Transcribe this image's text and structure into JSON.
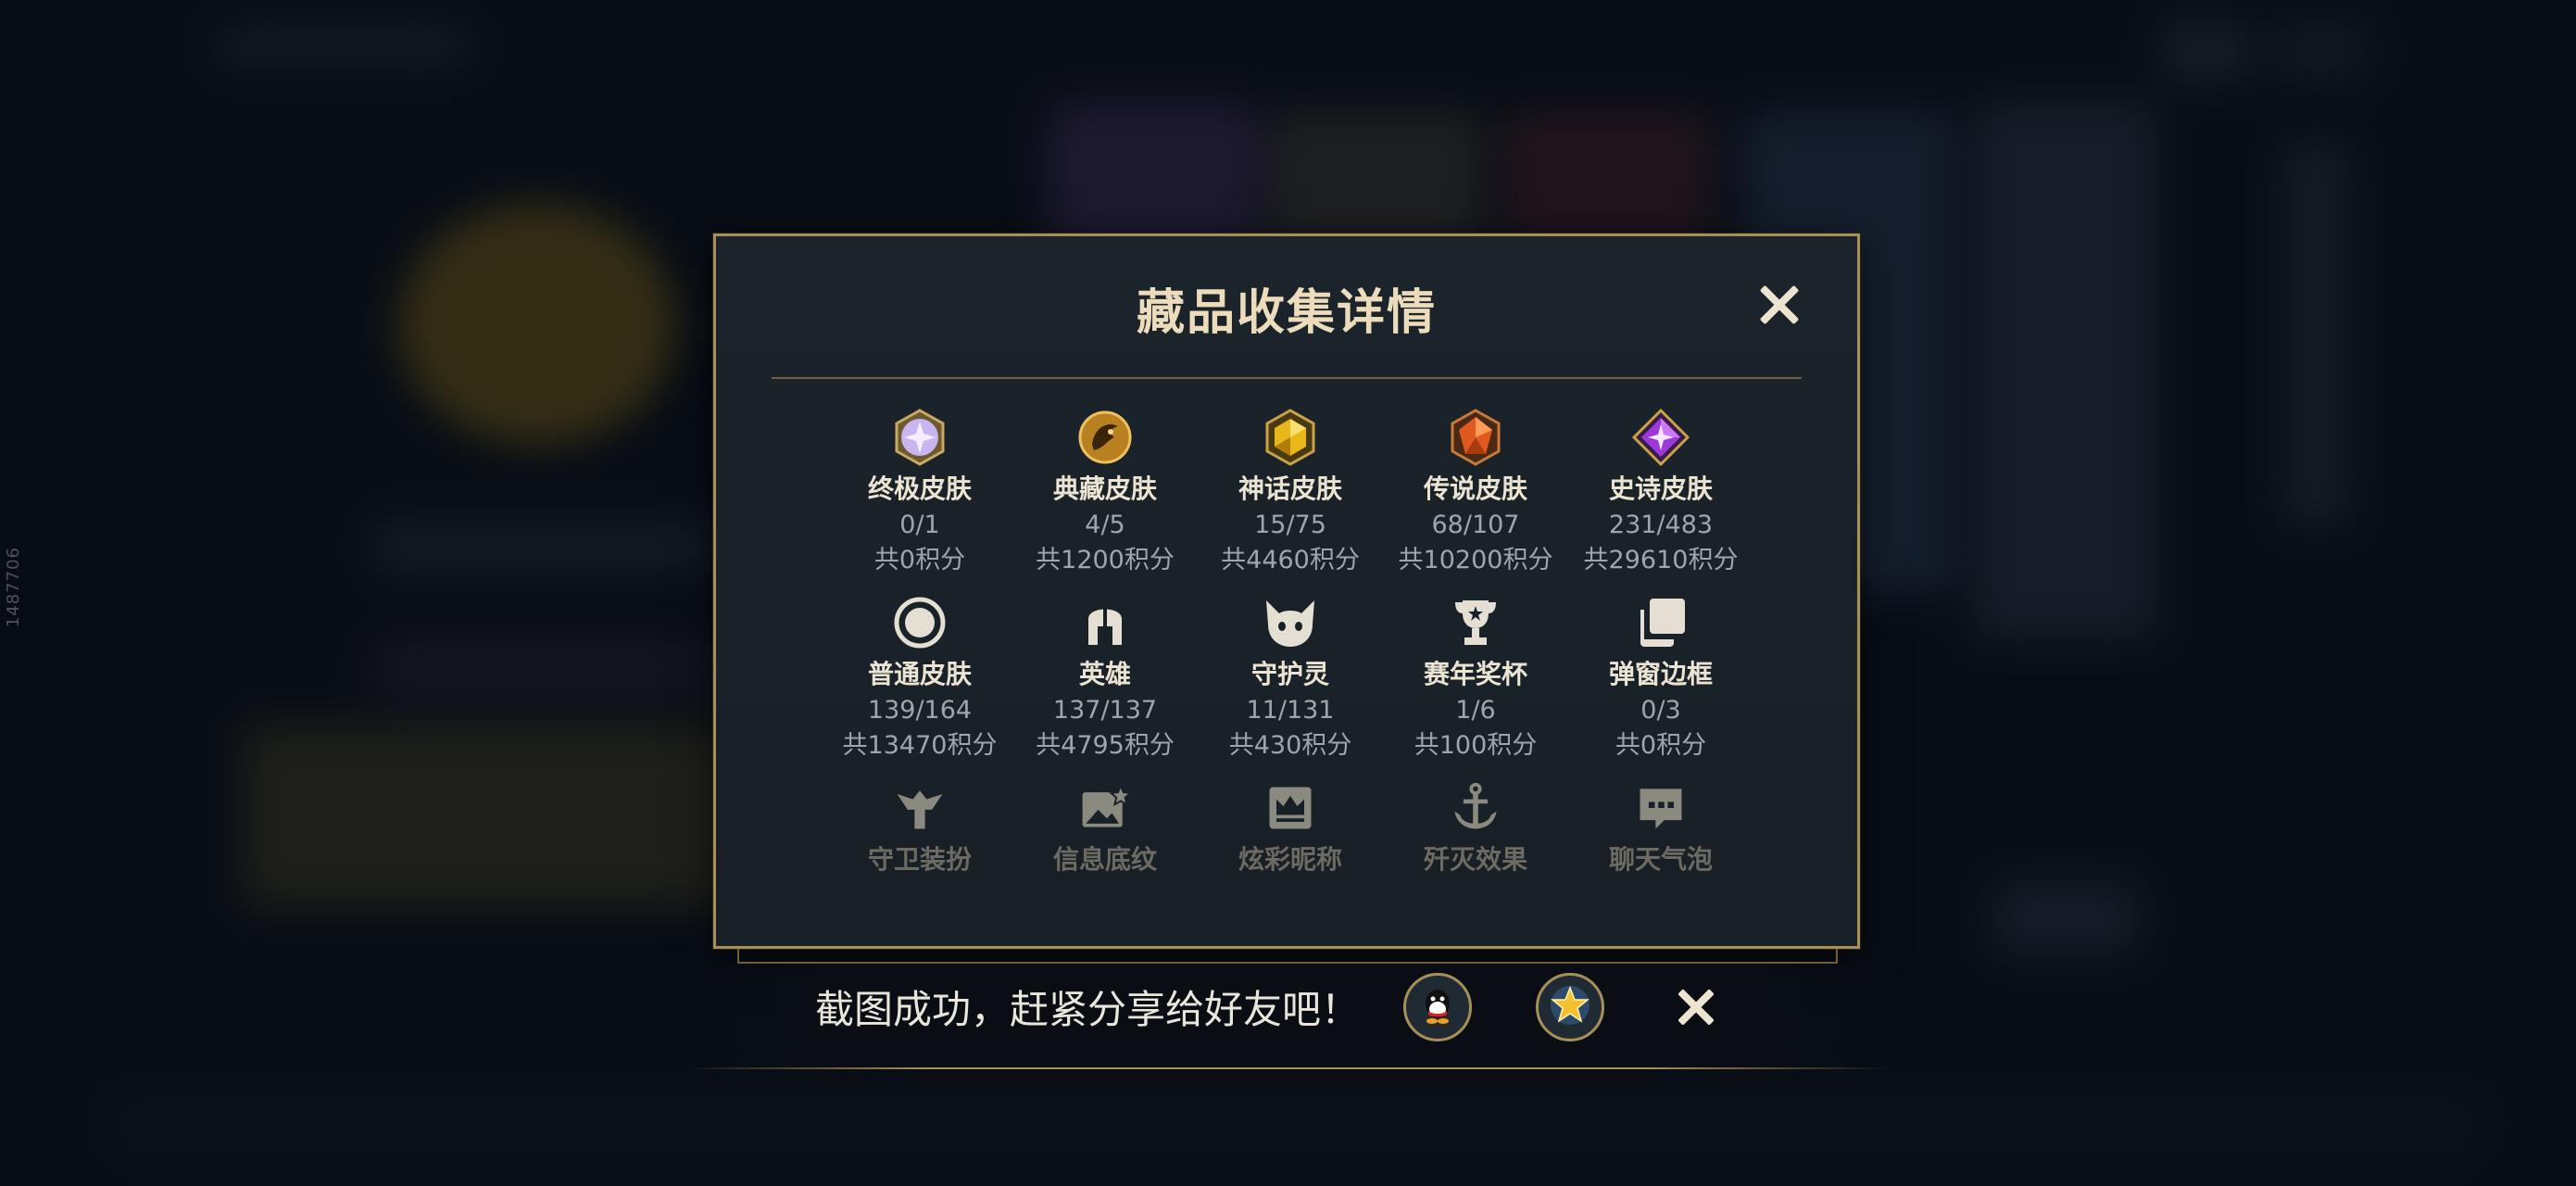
{
  "side_id": "1487706",
  "modal": {
    "title": "藏品收集详情",
    "close_label": "✕"
  },
  "collection": [
    {
      "icon": "ultimate-skin-icon",
      "name": "终极皮肤",
      "count": "0/1",
      "points": "共0积分"
    },
    {
      "icon": "prestige-skin-icon",
      "name": "典藏皮肤",
      "count": "4/5",
      "points": "共1200积分"
    },
    {
      "icon": "mythic-skin-icon",
      "name": "神话皮肤",
      "count": "15/75",
      "points": "共4460积分"
    },
    {
      "icon": "legendary-skin-icon",
      "name": "传说皮肤",
      "count": "68/107",
      "points": "共10200积分"
    },
    {
      "icon": "epic-skin-icon",
      "name": "史诗皮肤",
      "count": "231/483",
      "points": "共29610积分"
    },
    {
      "icon": "normal-skin-icon",
      "name": "普通皮肤",
      "count": "139/164",
      "points": "共13470积分"
    },
    {
      "icon": "champion-helmet-icon",
      "name": "英雄",
      "count": "137/137",
      "points": "共4795积分"
    },
    {
      "icon": "ward-spirit-icon",
      "name": "守护灵",
      "count": "11/131",
      "points": "共430积分"
    },
    {
      "icon": "trophy-icon",
      "name": "赛年奖杯",
      "count": "1/6",
      "points": "共100积分"
    },
    {
      "icon": "popup-frame-icon",
      "name": "弹窗边框",
      "count": "0/3",
      "points": "共0积分"
    },
    {
      "icon": "ward-skin-icon",
      "name": "守卫装扮"
    },
    {
      "icon": "banner-icon",
      "name": "信息底纹"
    },
    {
      "icon": "crown-nameplate-icon",
      "name": "炫彩昵称"
    },
    {
      "icon": "anchor-icon",
      "name": "歼灭效果"
    },
    {
      "icon": "chat-bubble-icon",
      "name": "聊天气泡"
    }
  ],
  "toast": {
    "message": "截图成功，赶紧分享给好友吧！",
    "share_targets": [
      "qq-share-icon",
      "star-share-icon"
    ]
  },
  "colors": {
    "gold": "#a88f5a",
    "title": "#ecdcbc",
    "label": "#ece4d2",
    "subtext": "#9ea6ab"
  }
}
